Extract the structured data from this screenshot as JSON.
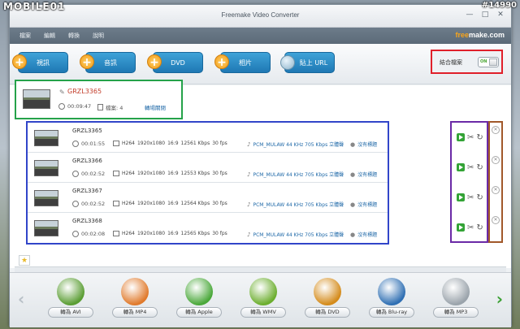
{
  "watermark": {
    "site": "MOBILE01",
    "id": "#14990"
  },
  "window": {
    "title": "Freemake Video Converter",
    "controls": [
      "—",
      "□",
      "✕"
    ]
  },
  "menu": [
    "檔案",
    "編輯",
    "轉換",
    "說明"
  ],
  "brand": {
    "part1": "free",
    "part2": "make.com"
  },
  "toolbar": {
    "buttons": [
      "視訊",
      "音訊",
      "DVD",
      "相片"
    ],
    "url_button": "貼上 URL",
    "join_label": "結合檔案",
    "toggle_state": "ON"
  },
  "group": {
    "name": "GRZL3365",
    "duration": "00:09:47",
    "file_count": "檔案: 4",
    "action": "轉場關閉"
  },
  "files": [
    {
      "name": "GRZL3365",
      "duration": "00:01:55",
      "codec": "H264",
      "resolution": "1920x1080",
      "aspect": "16:9",
      "bitrate": "12561 Kbps",
      "fps": "30 fps",
      "audio": "PCM_MULAW  44 KHz  705 Kbps  立體聲",
      "subs": "沒有標題"
    },
    {
      "name": "GRZL3366",
      "duration": "00:02:52",
      "codec": "H264",
      "resolution": "1920x1080",
      "aspect": "16:9",
      "bitrate": "12553 Kbps",
      "fps": "30 fps",
      "audio": "PCM_MULAW  44 KHz  705 Kbps  立體聲",
      "subs": "沒有標題"
    },
    {
      "name": "GRZL3367",
      "duration": "00:02:52",
      "codec": "H264",
      "resolution": "1920x1080",
      "aspect": "16:9",
      "bitrate": "12564 Kbps",
      "fps": "30 fps",
      "audio": "PCM_MULAW  44 KHz  705 Kbps  立體聲",
      "subs": "沒有標題"
    },
    {
      "name": "GRZL3368",
      "duration": "00:02:08",
      "codec": "H264",
      "resolution": "1920x1080",
      "aspect": "16:9",
      "bitrate": "12565 Kbps",
      "fps": "30 fps",
      "audio": "PCM_MULAW  44 KHz  705 Kbps  立體聲",
      "subs": "沒有標題"
    }
  ],
  "convert": [
    {
      "label": "轉為 AVI",
      "color": "#5a9d33"
    },
    {
      "label": "轉為 MP4",
      "color": "#e07a2c"
    },
    {
      "label": "轉為 Apple",
      "color": "#4aa83a"
    },
    {
      "label": "轉為 WMV",
      "color": "#6cae2f"
    },
    {
      "label": "轉為 DVD",
      "color": "#d48b1b"
    },
    {
      "label": "轉為 Blu-ray",
      "color": "#2f6fb3"
    },
    {
      "label": "轉為 MP3",
      "color": "#9aa3ab"
    }
  ],
  "colors": {
    "accent_blue": "#1f78b4",
    "join_box": "#e0202a",
    "group_box": "#25a24a",
    "files_box": "#3145c9",
    "edit_box": "#6b2aa6",
    "close_box": "#a1582a"
  }
}
